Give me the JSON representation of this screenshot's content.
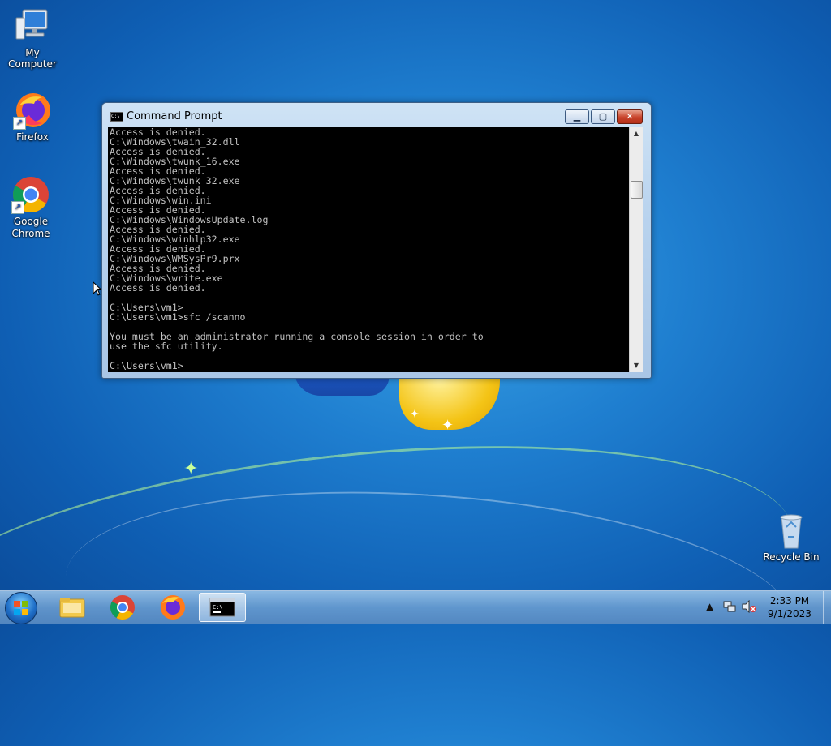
{
  "desktop": {
    "icons": [
      {
        "label": "My Computer",
        "icon": "computer-icon"
      },
      {
        "label": "Firefox",
        "icon": "firefox-icon"
      },
      {
        "label": "Google Chrome",
        "icon": "chrome-icon"
      },
      {
        "label": "Recycle Bin",
        "icon": "recycle-bin-icon"
      }
    ]
  },
  "window": {
    "title": "Command Prompt",
    "icon": "cmd-icon",
    "buttons": {
      "minimize": "minimize-icon",
      "maximize": "maximize-icon",
      "close": "close-icon"
    },
    "console_lines": [
      "Access is denied.",
      "C:\\Windows\\twain_32.dll",
      "Access is denied.",
      "C:\\Windows\\twunk_16.exe",
      "Access is denied.",
      "C:\\Windows\\twunk_32.exe",
      "Access is denied.",
      "C:\\Windows\\win.ini",
      "Access is denied.",
      "C:\\Windows\\WindowsUpdate.log",
      "Access is denied.",
      "C:\\Windows\\winhlp32.exe",
      "Access is denied.",
      "C:\\Windows\\WMSysPr9.prx",
      "Access is denied.",
      "C:\\Windows\\write.exe",
      "Access is denied.",
      "",
      "C:\\Users\\vm1>",
      "C:\\Users\\vm1>sfc /scanno",
      "",
      "You must be an administrator running a console session in order to",
      "use the sfc utility.",
      "",
      "C:\\Users\\vm1>"
    ],
    "scroll_position": 0.2
  },
  "taskbar": {
    "start_icon": "windows-start-icon",
    "pinned": [
      {
        "name": "file-explorer-icon"
      },
      {
        "name": "chrome-icon"
      },
      {
        "name": "firefox-icon"
      },
      {
        "name": "cmd-icon",
        "active": true
      }
    ],
    "tray": {
      "show_hidden": "chevron-up-icon",
      "network": "network-icon",
      "volume": "volume-muted-icon"
    },
    "clock": {
      "time": "2:33 PM",
      "date": "9/1/2023"
    }
  },
  "colors": {
    "console_bg": "#000000",
    "console_fg": "#c0c0c0",
    "close_button": "#c8422a"
  }
}
